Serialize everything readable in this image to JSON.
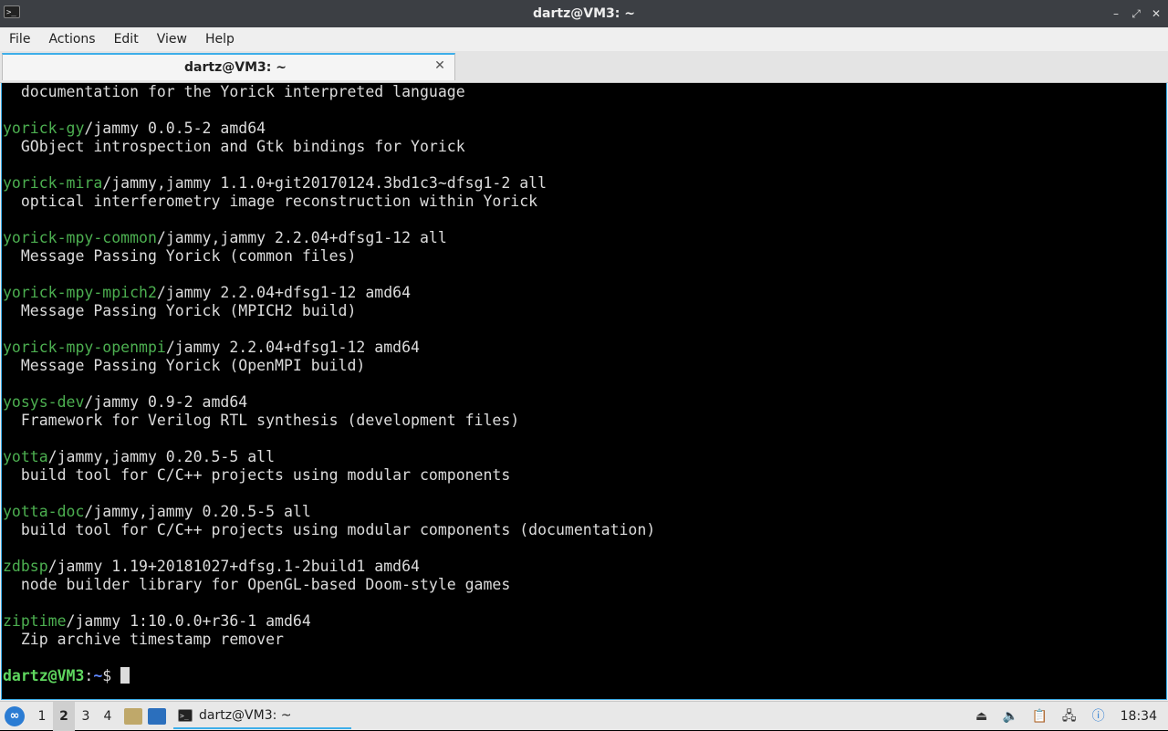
{
  "window": {
    "title": "dartz@VM3: ~",
    "menu": [
      "File",
      "Actions",
      "Edit",
      "View",
      "Help"
    ],
    "tab_label": "dartz@VM3: ~"
  },
  "terminal": {
    "lines": [
      {
        "type": "desc",
        "text": "  documentation for the Yorick interpreted language"
      },
      {
        "type": "blank"
      },
      {
        "type": "pkg",
        "name": "yorick-gy",
        "rest": "/jammy 0.0.5-2 amd64"
      },
      {
        "type": "desc",
        "text": "  GObject introspection and Gtk bindings for Yorick"
      },
      {
        "type": "blank"
      },
      {
        "type": "pkg",
        "name": "yorick-mira",
        "rest": "/jammy,jammy 1.1.0+git20170124.3bd1c3~dfsg1-2 all"
      },
      {
        "type": "desc",
        "text": "  optical interferometry image reconstruction within Yorick"
      },
      {
        "type": "blank"
      },
      {
        "type": "pkg",
        "name": "yorick-mpy-common",
        "rest": "/jammy,jammy 2.2.04+dfsg1-12 all"
      },
      {
        "type": "desc",
        "text": "  Message Passing Yorick (common files)"
      },
      {
        "type": "blank"
      },
      {
        "type": "pkg",
        "name": "yorick-mpy-mpich2",
        "rest": "/jammy 2.2.04+dfsg1-12 amd64"
      },
      {
        "type": "desc",
        "text": "  Message Passing Yorick (MPICH2 build)"
      },
      {
        "type": "blank"
      },
      {
        "type": "pkg",
        "name": "yorick-mpy-openmpi",
        "rest": "/jammy 2.2.04+dfsg1-12 amd64"
      },
      {
        "type": "desc",
        "text": "  Message Passing Yorick (OpenMPI build)"
      },
      {
        "type": "blank"
      },
      {
        "type": "pkg",
        "name": "yosys-dev",
        "rest": "/jammy 0.9-2 amd64"
      },
      {
        "type": "desc",
        "text": "  Framework for Verilog RTL synthesis (development files)"
      },
      {
        "type": "blank"
      },
      {
        "type": "pkg",
        "name": "yotta",
        "rest": "/jammy,jammy 0.20.5-5 all"
      },
      {
        "type": "desc",
        "text": "  build tool for C/C++ projects using modular components"
      },
      {
        "type": "blank"
      },
      {
        "type": "pkg",
        "name": "yotta-doc",
        "rest": "/jammy,jammy 0.20.5-5 all"
      },
      {
        "type": "desc",
        "text": "  build tool for C/C++ projects using modular components (documentation)"
      },
      {
        "type": "blank"
      },
      {
        "type": "pkg",
        "name": "zdbsp",
        "rest": "/jammy 1.19+20181027+dfsg.1-2build1 amd64"
      },
      {
        "type": "desc",
        "text": "  node builder library for OpenGL-based Doom-style games"
      },
      {
        "type": "blank"
      },
      {
        "type": "pkg",
        "name": "ziptime",
        "rest": "/jammy 1:10.0.0+r36-1 amd64"
      },
      {
        "type": "desc",
        "text": "  Zip archive timestamp remover"
      },
      {
        "type": "blank"
      }
    ],
    "prompt": {
      "user_host": "dartz@VM3",
      "sep": ":",
      "path": "~",
      "symbol": "$ "
    }
  },
  "taskbar": {
    "desktops": [
      "1",
      "2",
      "3",
      "4"
    ],
    "active_desktop": "2",
    "task_label": "dartz@VM3: ~",
    "clock": "18:34"
  },
  "colors": {
    "accent": "#3daee9",
    "package_name": "#4caf50",
    "prompt_user": "#5fd75f",
    "prompt_path": "#5f87ff"
  }
}
